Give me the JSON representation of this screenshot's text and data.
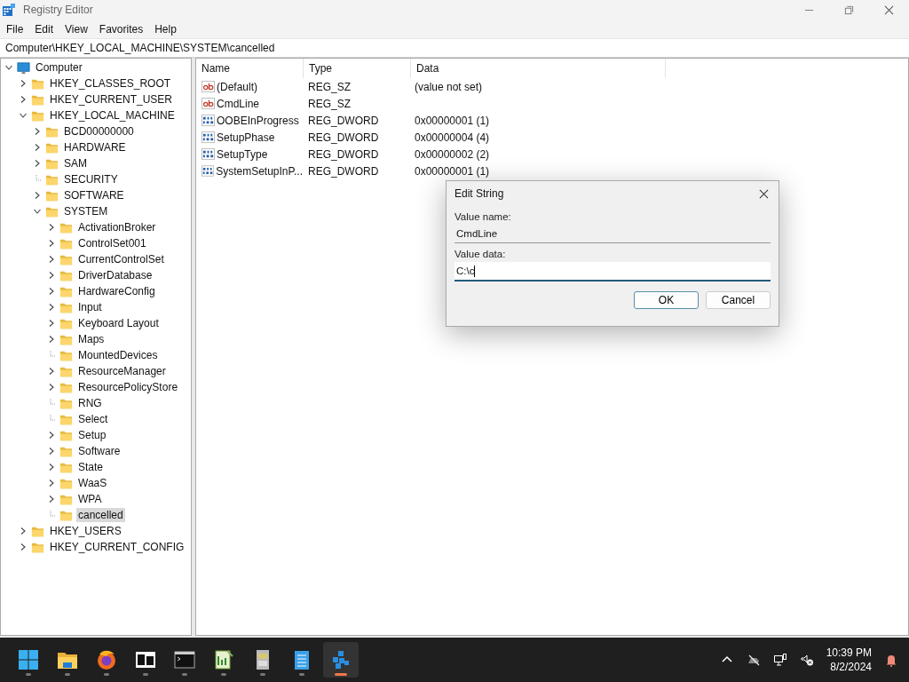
{
  "window": {
    "title": "Registry Editor"
  },
  "menu": [
    "File",
    "Edit",
    "View",
    "Favorites",
    "Help"
  ],
  "address": "Computer\\HKEY_LOCAL_MACHINE\\SYSTEM\\cancelled",
  "tree": [
    {
      "label": "Computer",
      "kind": "expanded",
      "selected": false,
      "children": [
        {
          "label": "HKEY_CLASSES_ROOT",
          "kind": "collapsed",
          "selected": false
        },
        {
          "label": "HKEY_CURRENT_USER",
          "kind": "collapsed",
          "selected": false
        },
        {
          "label": "HKEY_LOCAL_MACHINE",
          "kind": "expanded",
          "selected": false,
          "children": [
            {
              "label": "BCD00000000",
              "kind": "collapsed",
              "selected": false
            },
            {
              "label": "HARDWARE",
              "kind": "collapsed",
              "selected": false
            },
            {
              "label": "SAM",
              "kind": "collapsed",
              "selected": false
            },
            {
              "label": "SECURITY",
              "kind": "leaf",
              "selected": false
            },
            {
              "label": "SOFTWARE",
              "kind": "collapsed",
              "selected": false
            },
            {
              "label": "SYSTEM",
              "kind": "expanded",
              "selected": false,
              "children": [
                {
                  "label": "ActivationBroker",
                  "kind": "collapsed",
                  "selected": false
                },
                {
                  "label": "ControlSet001",
                  "kind": "collapsed",
                  "selected": false
                },
                {
                  "label": "CurrentControlSet",
                  "kind": "collapsed",
                  "selected": false
                },
                {
                  "label": "DriverDatabase",
                  "kind": "collapsed",
                  "selected": false
                },
                {
                  "label": "HardwareConfig",
                  "kind": "collapsed",
                  "selected": false
                },
                {
                  "label": "Input",
                  "kind": "collapsed",
                  "selected": false
                },
                {
                  "label": "Keyboard Layout",
                  "kind": "collapsed",
                  "selected": false
                },
                {
                  "label": "Maps",
                  "kind": "collapsed",
                  "selected": false
                },
                {
                  "label": "MountedDevices",
                  "kind": "leaf",
                  "selected": false
                },
                {
                  "label": "ResourceManager",
                  "kind": "collapsed",
                  "selected": false
                },
                {
                  "label": "ResourcePolicyStore",
                  "kind": "collapsed",
                  "selected": false
                },
                {
                  "label": "RNG",
                  "kind": "leaf",
                  "selected": false
                },
                {
                  "label": "Select",
                  "kind": "leaf",
                  "selected": false
                },
                {
                  "label": "Setup",
                  "kind": "collapsed",
                  "selected": false
                },
                {
                  "label": "Software",
                  "kind": "collapsed",
                  "selected": false
                },
                {
                  "label": "State",
                  "kind": "collapsed",
                  "selected": false
                },
                {
                  "label": "WaaS",
                  "kind": "collapsed",
                  "selected": false
                },
                {
                  "label": "WPA",
                  "kind": "collapsed",
                  "selected": false
                },
                {
                  "label": "cancelled",
                  "kind": "leaf",
                  "selected": true
                }
              ]
            }
          ]
        },
        {
          "label": "HKEY_USERS",
          "kind": "collapsed",
          "selected": false
        },
        {
          "label": "HKEY_CURRENT_CONFIG",
          "kind": "collapsed",
          "selected": false
        }
      ]
    }
  ],
  "table": {
    "columns": [
      "Name",
      "Type",
      "Data"
    ],
    "rows": [
      {
        "kind": "string",
        "name": "(Default)",
        "type": "REG_SZ",
        "data": "(value not set)"
      },
      {
        "kind": "string",
        "name": "CmdLine",
        "type": "REG_SZ"
      },
      {
        "kind": "binary",
        "name": "OOBEInProgress",
        "type": "REG_DWORD",
        "data": "0x00000001 (1)"
      },
      {
        "kind": "binary",
        "name": "SetupPhase",
        "type": "REG_DWORD",
        "data": "0x00000004 (4)"
      },
      {
        "kind": "binary",
        "name": "SetupType",
        "type": "REG_DWORD",
        "data": "0x00000002 (2)"
      },
      {
        "kind": "binary",
        "name": "SystemSetupInP...",
        "type": "REG_DWORD",
        "data": "0x00000001 (1)"
      }
    ]
  },
  "dialog": {
    "title": "Edit String",
    "name_label": "Value name:",
    "name_value": "CmdLine",
    "data_label": "Value data:",
    "data_value": "C:\\c",
    "ok": "OK",
    "cancel": "Cancel"
  },
  "taskbar": {
    "apps": [
      {
        "kind": "start",
        "selected": false
      },
      {
        "kind": "folder",
        "selected": false
      },
      {
        "kind": "browser",
        "selected": false
      },
      {
        "kind": "archiver",
        "selected": false
      },
      {
        "kind": "terminal",
        "selected": false
      },
      {
        "kind": "editor",
        "selected": false
      },
      {
        "kind": "cabinet",
        "selected": false
      },
      {
        "kind": "notepad",
        "selected": false
      },
      {
        "kind": "registry",
        "selected": true
      }
    ],
    "time": "10:39 PM",
    "date": "8/2/2024"
  }
}
